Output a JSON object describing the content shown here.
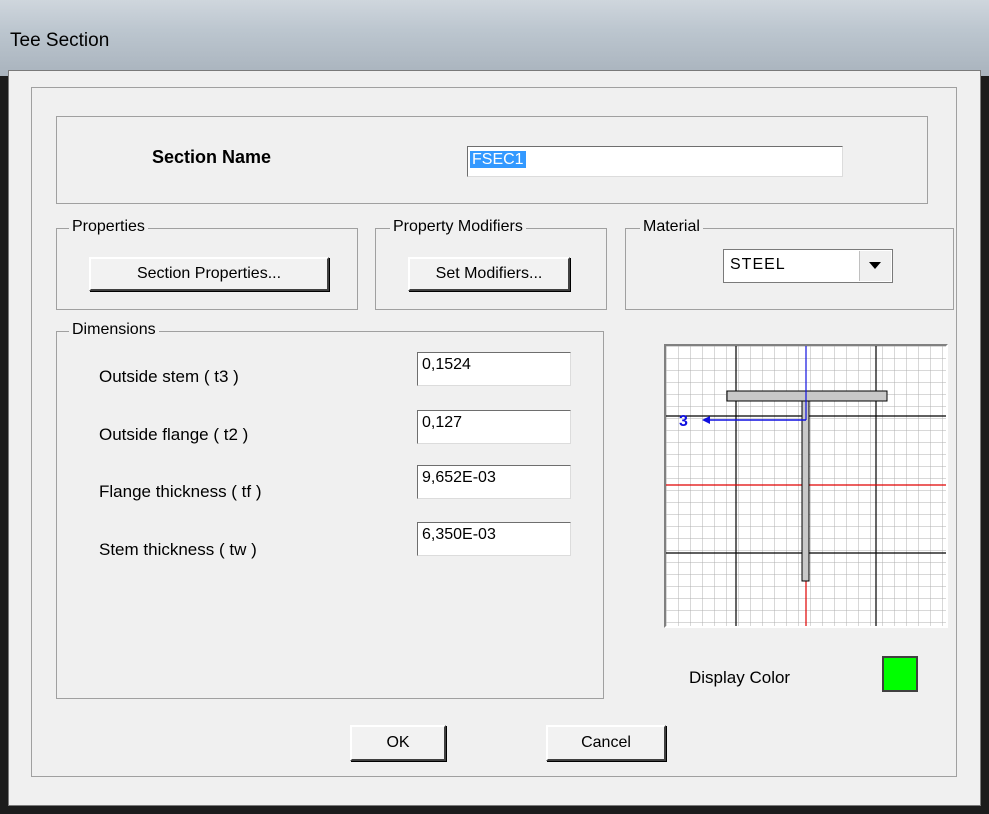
{
  "window": {
    "title": "Tee Section"
  },
  "section_name": {
    "label": "Section Name",
    "value": "FSEC1"
  },
  "properties": {
    "group_label": "Properties",
    "button_label": "Section Properties..."
  },
  "property_modifiers": {
    "group_label": "Property Modifiers",
    "button_label": "Set Modifiers..."
  },
  "material": {
    "group_label": "Material",
    "selected": "STEEL"
  },
  "dimensions": {
    "group_label": "Dimensions",
    "fields": [
      {
        "label": "Outside stem  ( t3 )",
        "value": "0,1524"
      },
      {
        "label": "Outside flange  ( t2 )",
        "value": "0,127"
      },
      {
        "label": "Flange thickness  ( tf )",
        "value": "9,652E-03"
      },
      {
        "label": "Stem thickness  ( tw )",
        "value": "6,350E-03"
      }
    ]
  },
  "preview": {
    "axis_label": "3"
  },
  "display_color": {
    "label": "Display Color",
    "color": "#00ff00"
  },
  "buttons": {
    "ok": "OK",
    "cancel": "Cancel"
  }
}
